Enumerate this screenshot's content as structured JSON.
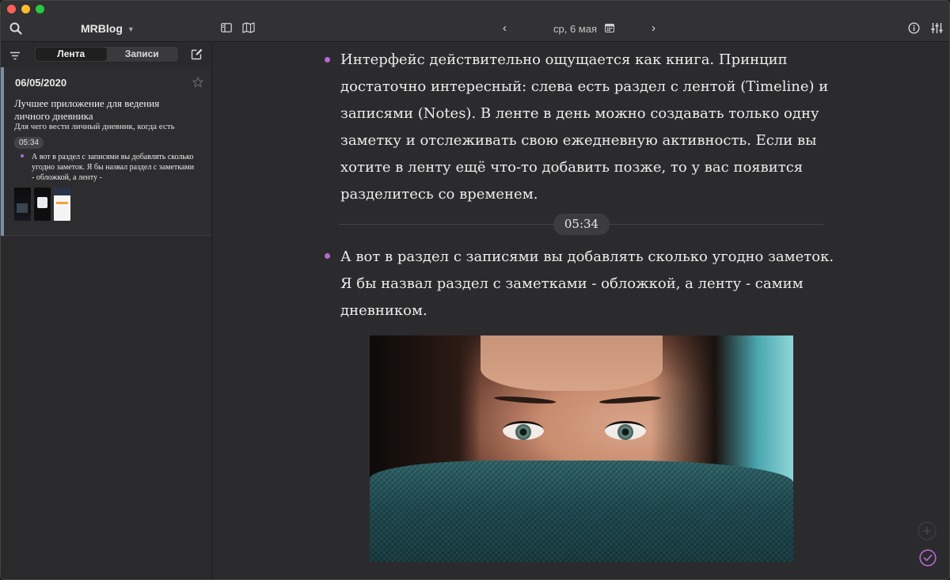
{
  "app": {
    "title": "MRBlog"
  },
  "toolbar": {
    "date_label": "ср, 6 мая",
    "prev_label": "‹",
    "next_label": "›"
  },
  "sidebar": {
    "tabs": [
      {
        "label": "Лента",
        "active": true
      },
      {
        "label": "Записи",
        "active": false
      }
    ],
    "entries": [
      {
        "date": "06/05/2020",
        "title": "Лучшее приложение для ведения личного дневника",
        "subtitle": "Для чего вести личный дневник, когда есть",
        "time": "05:34",
        "excerpt": "А вот в раздел с записями вы добавлять сколько угодно заметок. Я бы назвал раздел с заметками - обложкой, а ленту -"
      }
    ]
  },
  "content": {
    "paragraph_1": "Интерфейс действительно ощущается как книга. Принцип достаточно интересный: слева есть раздел с лентой (Timeline) и записями (Notes). В ленте в день можно создавать только одну заметку и отслеживать свою ежедневную активность. Если вы хотите в ленту ещё что-то добавить позже, то у вас появится разделитесь со временем.",
    "time_badge": "05:34",
    "paragraph_2": "А вот в раздел с записями вы добавлять сколько угодно заметок. Я бы назвал раздел с заметками - обложкой, а ленту - самим дневником."
  },
  "colors": {
    "accent_bullet": "#b569d1",
    "entry_accent": "#7c8ea5",
    "window_bg": "#2b2b2d"
  },
  "icons": [
    "search-icon",
    "chevron-down-icon",
    "sidebar-toggle-icon",
    "map-icon",
    "calendar-icon",
    "info-icon",
    "sliders-icon",
    "filter-icon",
    "compose-icon",
    "star-icon",
    "add-icon",
    "check-circle-icon"
  ]
}
